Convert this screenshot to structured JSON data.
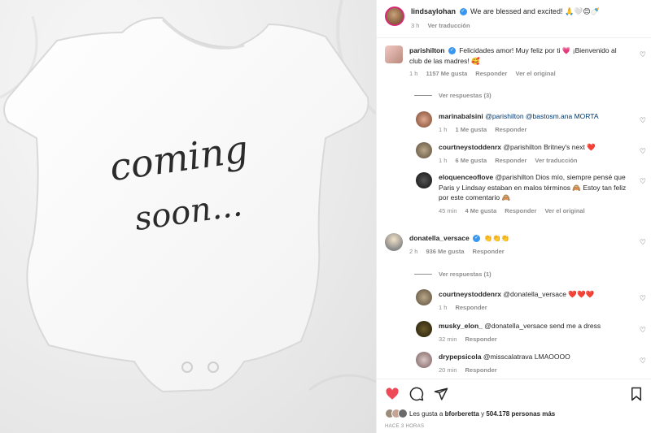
{
  "photo": {
    "line1": "coming",
    "line2": "soon..."
  },
  "post": {
    "username": "lindsaylohan",
    "caption": "We are blessed and excited! 🙏🤍😊🍼",
    "time": "3 h",
    "translate": "Ver traducción"
  },
  "comments": [
    {
      "username": "parishilton",
      "verified": true,
      "text": "Felicidades amor! Muy feliz por ti 💗 ¡Bienvenido al club de las madres! 🥰",
      "time": "1 h",
      "likes": "1157 Me gusta",
      "reply": "Responder",
      "extra": "Ver el original",
      "view_replies": "Ver respuestas (3)"
    },
    {
      "username": "marinabalsini",
      "text": "@parishilton @bastosm.ana MORTA",
      "time": "1 h",
      "likes": "1 Me gusta",
      "reply": "Responder"
    },
    {
      "username": "courtneystoddenrx",
      "text": "@parishilton Britney's next ❤️",
      "time": "1 h",
      "likes": "6 Me gusta",
      "reply": "Responder",
      "extra": "Ver traducción"
    },
    {
      "username": "eloquenceoflove",
      "text": "@parishilton Dios mío, siempre pensé que Paris y Lindsay estaban en malos términos 🙈 Estoy tan feliz por este comentario 🙈",
      "time": "45 min",
      "likes": "4 Me gusta",
      "reply": "Responder",
      "extra": "Ver el original"
    },
    {
      "username": "donatella_versace",
      "verified": true,
      "text": "👏👏👏",
      "time": "2 h",
      "likes": "936 Me gusta",
      "reply": "Responder",
      "view_replies": "Ver respuestas (1)"
    },
    {
      "username": "courtneystoddenrx",
      "text": "@donatella_versace ❤️❤️❤️",
      "time": "1 h",
      "reply": "Responder"
    },
    {
      "username": "musky_elon_",
      "text": "@donatella_versace send me a dress",
      "time": "32 min",
      "reply": "Responder"
    },
    {
      "username": "drypepsicola",
      "text": "@misscalatrava LMAOOOO",
      "time": "20 min",
      "reply": "Responder"
    }
  ],
  "footer": {
    "likes_prefix": "Les gusta a",
    "likes_user": "bforberetta",
    "likes_mid": "y",
    "likes_count": "504.178 personas más",
    "posted": "HACE 3 HORAS"
  },
  "colors": {
    "heart": "#ed4956",
    "mention": "#00376b",
    "muted": "#8e8e8e",
    "verified": "#3897f0"
  },
  "icons": [
    "heart-icon",
    "comment-icon",
    "share-icon",
    "bookmark-icon"
  ]
}
